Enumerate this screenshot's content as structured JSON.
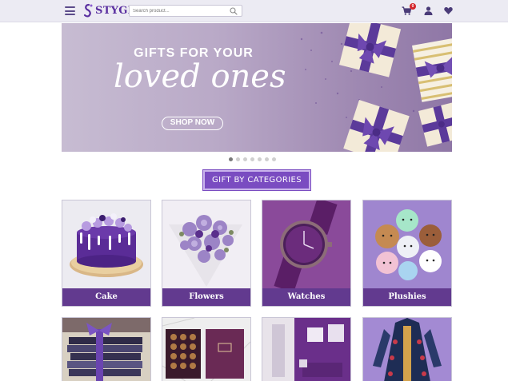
{
  "header": {
    "logo_text": "STYGEN",
    "search": {
      "placeholder": "Search product..."
    },
    "cart_count": "0",
    "icons": [
      "menu-icon",
      "search-icon",
      "cart-icon",
      "user-icon",
      "heart-icon"
    ]
  },
  "banner": {
    "title": "GIFTS FOR YOUR",
    "script": "loved ones",
    "cta": "SHOP NOW",
    "slide_count": 7,
    "active_slide": 1
  },
  "section": {
    "title": "GIFT BY CATEGORIES"
  },
  "categories": [
    {
      "label": "Cake"
    },
    {
      "label": "Flowers"
    },
    {
      "label": "Watches"
    },
    {
      "label": "Plushies"
    }
  ],
  "colors": {
    "brand": "#5a2fa0",
    "label_bg": "#623a8f",
    "badge": "#d4262a",
    "section_bg": "#7a4cc1"
  }
}
